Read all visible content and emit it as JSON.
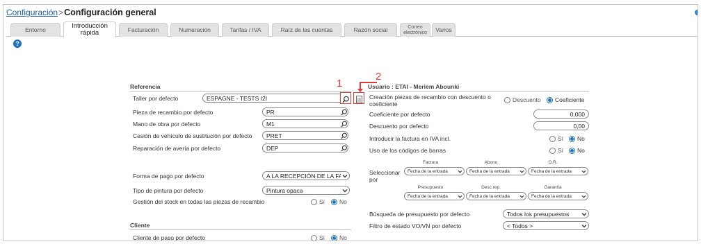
{
  "breadcrumb": {
    "parent": "Configuración",
    "separator": ">",
    "current": "Configuración general"
  },
  "tabs": [
    {
      "label": "Entorno"
    },
    {
      "label": "Introducción rápida"
    },
    {
      "label": "Facturación"
    },
    {
      "label": "Numeración"
    },
    {
      "label": "Tarifas / IVA"
    },
    {
      "label": "Raíz de las cuentas"
    },
    {
      "label": "Razón social"
    },
    {
      "label": "Correo electrónico"
    },
    {
      "label": "Varios"
    }
  ],
  "annotations": {
    "one": "1",
    "two": "2"
  },
  "referencia": {
    "title": "Referencia",
    "taller": {
      "label": "Taller por defecto",
      "value": "ESPAGNE - TESTS I2I"
    },
    "pieza": {
      "label": "Pieza de recambio por defecto",
      "value": "PR"
    },
    "mano": {
      "label": "Mano de obra por defecto",
      "value": "M1"
    },
    "cesion": {
      "label": "Cesión de vehículo de sustitución por defecto",
      "value": "PRET"
    },
    "reparacion": {
      "label": "Reparación de avería por defecto",
      "value": "DEP"
    },
    "forma_pago": {
      "label": "Forma de pago por defecto",
      "value": "A LA RECEPCIÓN DE LA FAC"
    },
    "pintura": {
      "label": "Tipo de pintura por defecto",
      "value": "Pintura opaca"
    },
    "stock": {
      "label": "Gestión del stock en todas las piezas de recambio",
      "si": "Sí",
      "no": "No"
    }
  },
  "cliente": {
    "title": "Cliente",
    "paso": {
      "label": "Cliente de paso por defecto",
      "si": "Sí",
      "no": "No"
    }
  },
  "usuario": {
    "title": "Usuario : ETAI - Meriem Abounki",
    "creacion": {
      "label": "Creación piezas de recambio con descuento o coeficiente",
      "opt1": "Descuento",
      "opt2": "Coeficiente"
    },
    "coef": {
      "label": "Coeficiente por defecto",
      "value": "0,000"
    },
    "desc": {
      "label": "Descuento por defecto",
      "value": "0,00"
    },
    "iva": {
      "label": "Introducir la factura en IVA incl.",
      "si": "Sí",
      "no": "No"
    },
    "barras": {
      "label": "Uso de los códigos de barras",
      "si": "Sí",
      "no": "No"
    },
    "seleccionar": {
      "label": "Seleccionar por",
      "headers1": [
        "Factura",
        "Abono",
        "O.R."
      ],
      "headers2": [
        "Presupuesto",
        "Desc.rep.",
        "Garantía"
      ],
      "value": "Fecha de la entrada"
    },
    "busqueda": {
      "label": "Búsqueda de presupuesto por defecto",
      "value": "Todos los presupuestos"
    },
    "filtro": {
      "label": "Filtro de estado VO/VN por defecto",
      "value": "< Todos >"
    }
  }
}
